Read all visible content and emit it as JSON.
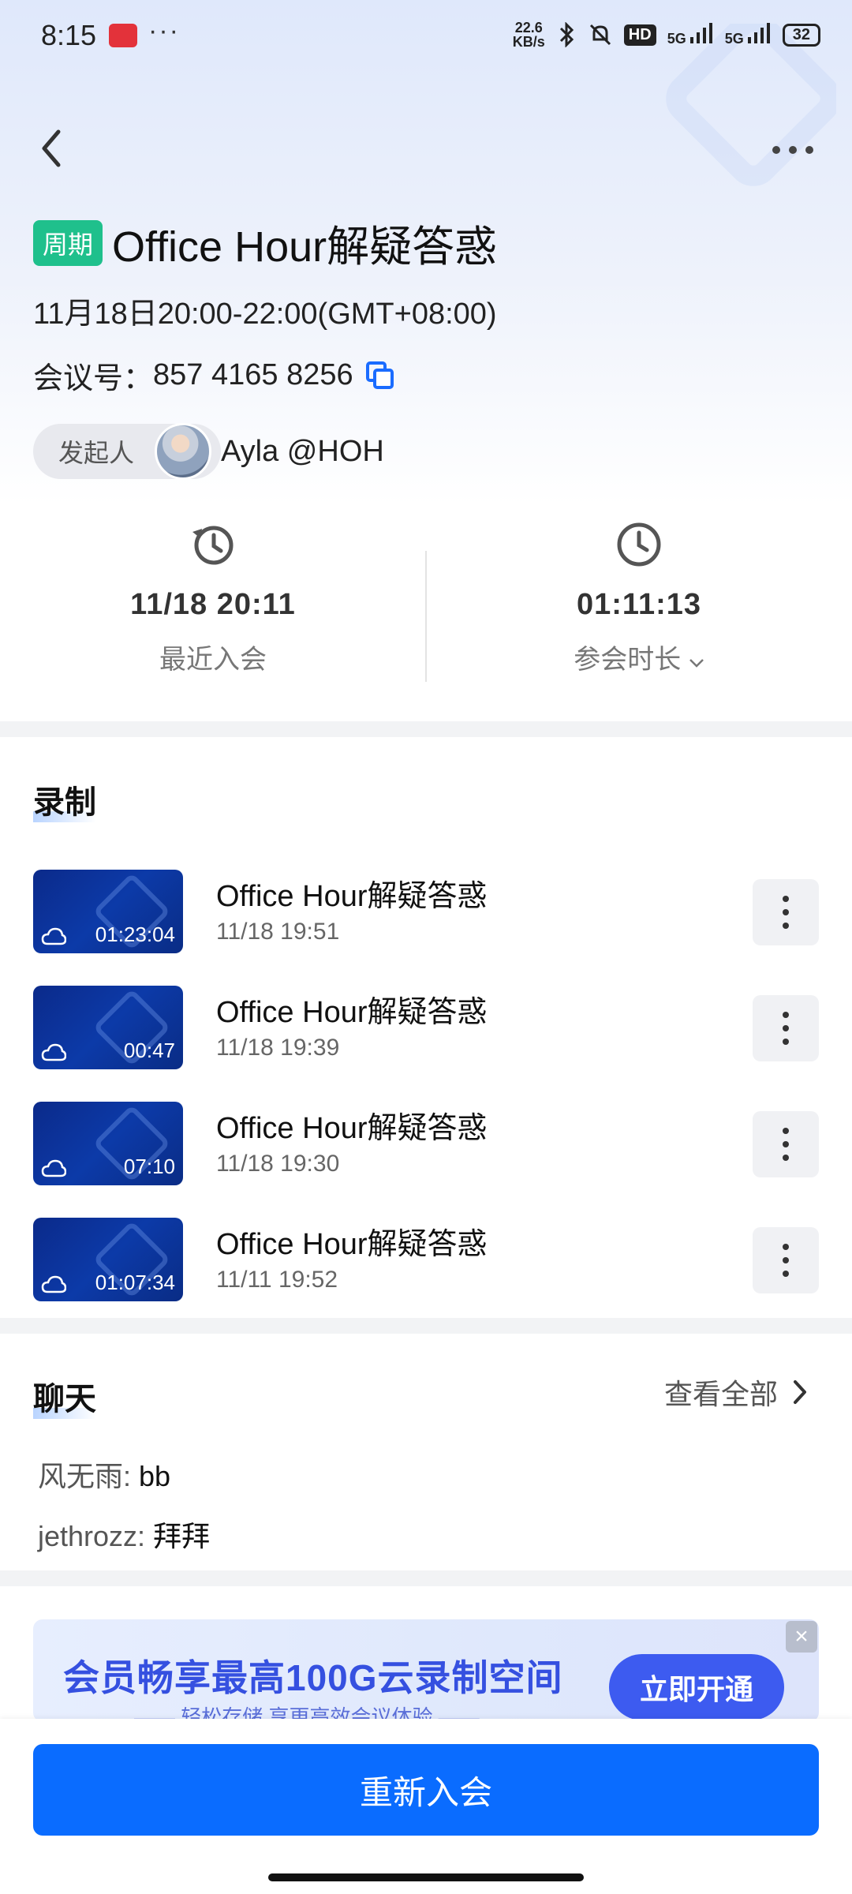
{
  "status_bar": {
    "time": "8:15",
    "dots": "···",
    "speed": "22.6",
    "speed_unit": "KB/s",
    "hd": "HD",
    "sig1": "5G",
    "sig2": "5G",
    "battery": "32"
  },
  "header": {
    "tag": "周期",
    "title": "Office Hour解疑答惑",
    "time_range": "11月18日20:00-22:00(GMT+08:00)",
    "meeting_id_label": "会议号：",
    "meeting_id": "857 4165 8256",
    "host_label": "发起人",
    "host_name": "Ayla @HOH"
  },
  "stats": {
    "last_join_value": "11/18 20:11",
    "last_join_label": "最近入会",
    "duration_value": "01:11:13",
    "duration_label": "参会时长"
  },
  "recordings": {
    "section_title": "录制",
    "items": [
      {
        "title": "Office Hour解疑答惑",
        "time": "11/18 19:51",
        "duration": "01:23:04"
      },
      {
        "title": "Office Hour解疑答惑",
        "time": "11/18 19:39",
        "duration": "00:47"
      },
      {
        "title": "Office Hour解疑答惑",
        "time": "11/18 19:30",
        "duration": "07:10"
      },
      {
        "title": "Office Hour解疑答惑",
        "time": "11/11 19:52",
        "duration": "01:07:34"
      }
    ]
  },
  "chat": {
    "section_title": "聊天",
    "view_all": "查看全部",
    "messages": [
      {
        "sender": "风无雨:",
        "text": "bb"
      },
      {
        "sender": "jethrozz:",
        "text": "拜拜"
      }
    ]
  },
  "promo": {
    "main": "会员畅享最高100G云录制空间",
    "sub": "—— 轻松存储  享更高效会议体验 ——",
    "button": "立即开通"
  },
  "footer": {
    "rejoin": "重新入会"
  },
  "colors": {
    "accent": "#0a6cff",
    "tag_green": "#1fc08c",
    "promo_blue": "#3550e0"
  }
}
